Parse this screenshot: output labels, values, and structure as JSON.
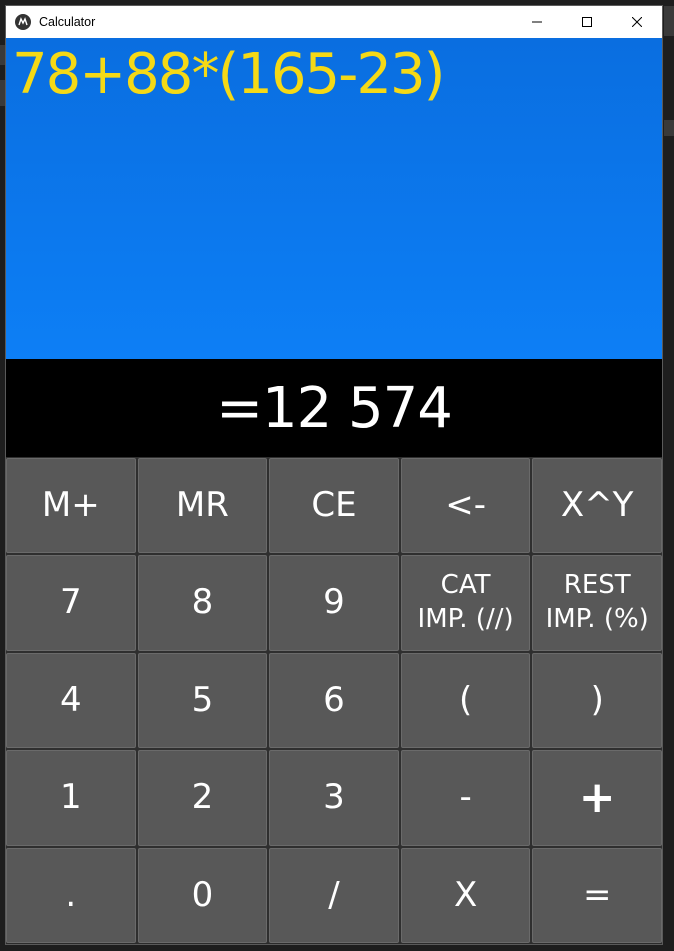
{
  "window": {
    "title": "Calculator",
    "icon": "kivy-logo-icon",
    "controls": [
      "minimize-icon",
      "maximize-icon",
      "close-icon"
    ]
  },
  "display": {
    "expression": "78+88*(165-23)",
    "result": "=12 574"
  },
  "keys": [
    {
      "label": "M+",
      "name": "memory-add-button"
    },
    {
      "label": "MR",
      "name": "memory-recall-button"
    },
    {
      "label": "CE",
      "name": "clear-entry-button"
    },
    {
      "label": "<-",
      "name": "backspace-button"
    },
    {
      "label": "X^Y",
      "name": "power-button"
    },
    {
      "label": "7",
      "name": "digit-7-button"
    },
    {
      "label": "8",
      "name": "digit-8-button"
    },
    {
      "label": "9",
      "name": "digit-9-button"
    },
    {
      "label": "CAT\nIMP. (//)",
      "name": "floor-division-button"
    },
    {
      "label": "REST\nIMP. (%)",
      "name": "modulo-button"
    },
    {
      "label": "4",
      "name": "digit-4-button"
    },
    {
      "label": "5",
      "name": "digit-5-button"
    },
    {
      "label": "6",
      "name": "digit-6-button"
    },
    {
      "label": "(",
      "name": "open-paren-button"
    },
    {
      "label": ")",
      "name": "close-paren-button"
    },
    {
      "label": "1",
      "name": "digit-1-button"
    },
    {
      "label": "2",
      "name": "digit-2-button"
    },
    {
      "label": "3",
      "name": "digit-3-button"
    },
    {
      "label": "-",
      "name": "subtract-button"
    },
    {
      "label": "+",
      "name": "add-button"
    },
    {
      "label": ".",
      "name": "decimal-point-button"
    },
    {
      "label": "0",
      "name": "digit-0-button"
    },
    {
      "label": "/",
      "name": "divide-button"
    },
    {
      "label": "X",
      "name": "multiply-button"
    },
    {
      "label": "=",
      "name": "equals-button"
    }
  ],
  "colors": {
    "expression_bg": "#0d7ff6",
    "expression_text": "#f5d916",
    "result_bg": "#000000",
    "result_text": "#ffffff",
    "key_bg": "#585858"
  }
}
